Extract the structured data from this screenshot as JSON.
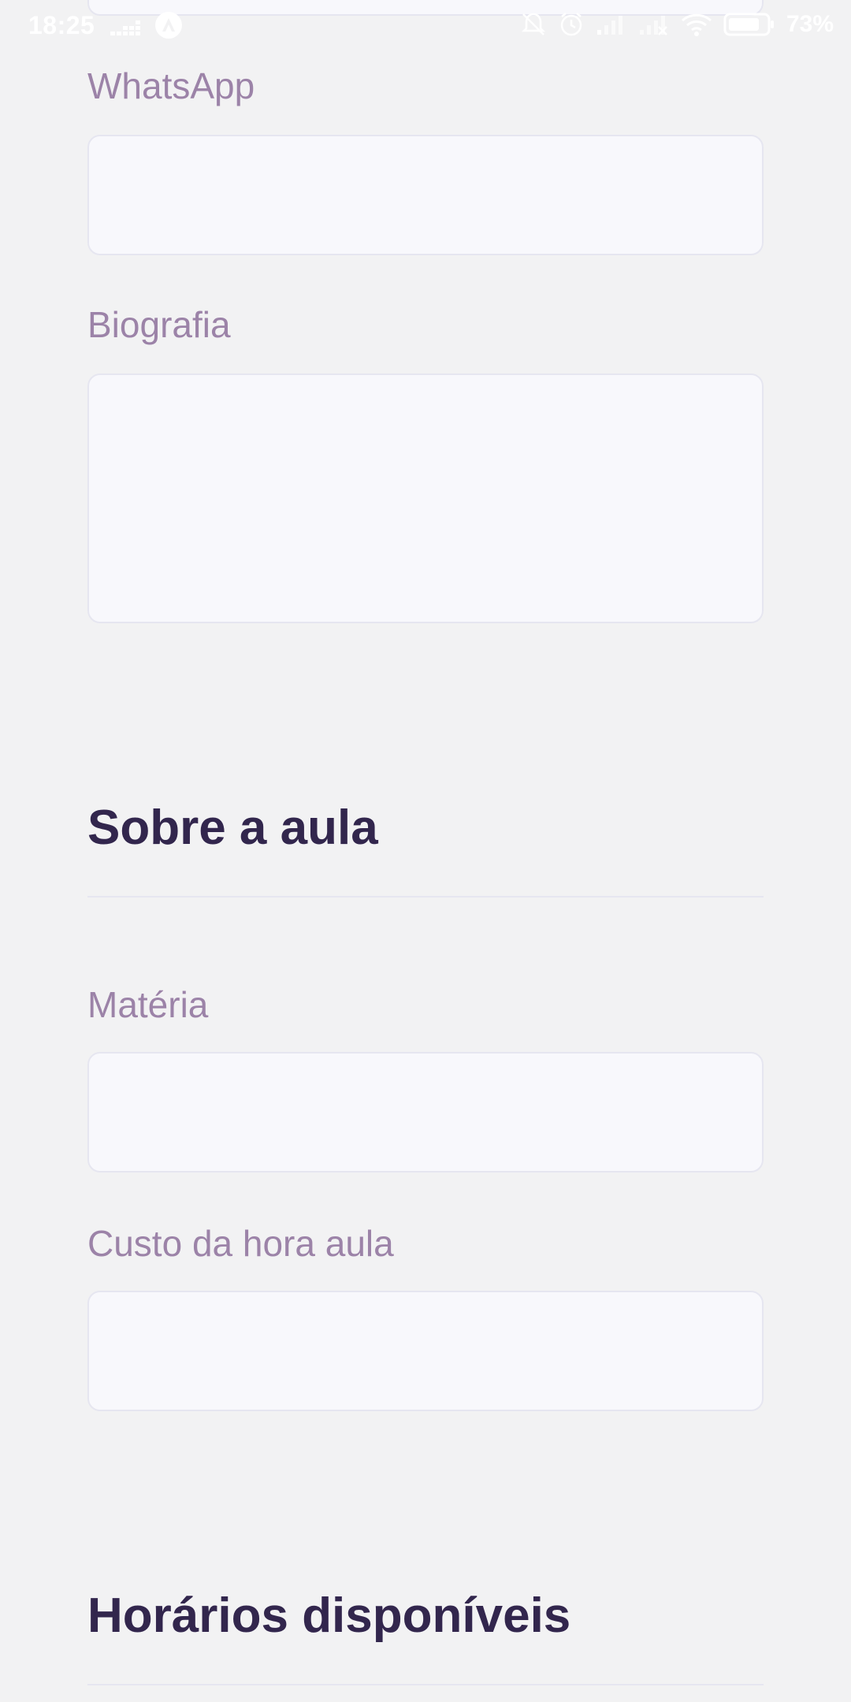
{
  "status_bar": {
    "time": "18:25",
    "battery": "73%",
    "icons": [
      "deezer-icon",
      "app-logo-icon",
      "notifications-off-icon",
      "alarm-icon",
      "signal-icon",
      "signal-no-service-icon",
      "wifi-icon",
      "battery-icon"
    ]
  },
  "form": {
    "whatsapp": {
      "label": "WhatsApp",
      "value": ""
    },
    "bio": {
      "label": "Biografia",
      "value": ""
    },
    "section_class": {
      "title": "Sobre a aula"
    },
    "subject": {
      "label": "Matéria",
      "value": ""
    },
    "cost": {
      "label": "Custo da hora aula",
      "value": ""
    },
    "section_schedule": {
      "title": "Horários disponíveis"
    }
  },
  "colors": {
    "background": "#f2f2f3",
    "label": "#9c83a8",
    "title": "#32264d",
    "input_bg": "#f8f8fc",
    "input_border": "#e6e6f0"
  }
}
